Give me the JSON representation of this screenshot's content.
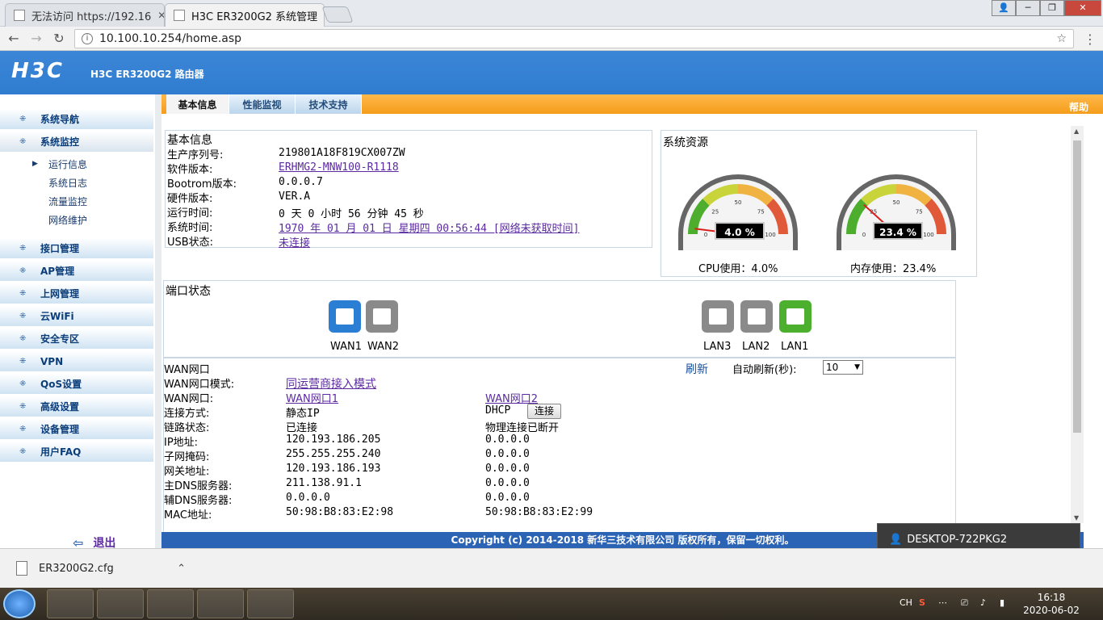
{
  "browser": {
    "tabs": [
      {
        "title": "无法访问 https://192.16"
      },
      {
        "title": "H3C ER3200G2 系统管理"
      }
    ],
    "url": "10.100.10.254/home.asp"
  },
  "header": {
    "logo": "H3C",
    "model": "H3C ER3200G2 路由器"
  },
  "sidebar": {
    "items": [
      {
        "label": "系统导航"
      },
      {
        "label": "系统监控"
      },
      {
        "label": "接口管理"
      },
      {
        "label": "AP管理"
      },
      {
        "label": "上网管理"
      },
      {
        "label": "云WiFi"
      },
      {
        "label": "安全专区"
      },
      {
        "label": "VPN"
      },
      {
        "label": "QoS设置"
      },
      {
        "label": "高级设置"
      },
      {
        "label": "设备管理"
      },
      {
        "label": "用户FAQ"
      }
    ],
    "sub_items": [
      {
        "label": "运行信息"
      },
      {
        "label": "系统日志"
      },
      {
        "label": "流量监控"
      },
      {
        "label": "网络维护"
      }
    ],
    "logout": "退出"
  },
  "tabs": [
    {
      "label": "基本信息"
    },
    {
      "label": "性能监视"
    },
    {
      "label": "技术支持"
    }
  ],
  "help": "帮助",
  "basic_info": {
    "title": "基本信息",
    "rows": [
      {
        "label": "生产序列号:",
        "value": "219801A18F819CX007ZW"
      },
      {
        "label": "软件版本:",
        "value": "ERHMG2-MNW100-R1118"
      },
      {
        "label": "Bootrom版本:",
        "value": "0.0.0.7"
      },
      {
        "label": "硬件版本:",
        "value": "VER.A"
      },
      {
        "label": "运行时间:",
        "value": "0 天 0 小时 56 分钟 45 秒"
      },
      {
        "label": "系统时间:",
        "value": "1970 年 01 月 01 日 星期四 00:56:44    [网络未获取时间]"
      },
      {
        "label": "USB状态:",
        "value": "未连接"
      }
    ]
  },
  "resources": {
    "title": "系统资源",
    "cpu": {
      "value": 4.0,
      "display": "4.0 %",
      "label": "CPU使用：4.0%"
    },
    "mem": {
      "value": 23.4,
      "display": "23.4 %",
      "label": "内存使用：23.4%"
    },
    "ticks": [
      "0",
      "25",
      "50",
      "75",
      "100"
    ]
  },
  "ports": {
    "title": "端口状态",
    "items": [
      {
        "label": "WAN1",
        "state": "active-blue"
      },
      {
        "label": "WAN2",
        "state": "inactive"
      },
      {
        "label": "LAN3",
        "state": "inactive"
      },
      {
        "label": "LAN2",
        "state": "inactive"
      },
      {
        "label": "LAN1",
        "state": "active-green"
      }
    ]
  },
  "wan": {
    "title": "WAN网口",
    "refresh": "刷新",
    "auto_refresh_label": "自动刷新(秒):",
    "auto_refresh_value": "10",
    "mode_label": "WAN网口模式:",
    "mode_value": "同运营商接入模式",
    "port_label": "WAN网口:",
    "port1": "WAN网口1",
    "port2": "WAN网口2",
    "connect_button": "连接",
    "rows": [
      {
        "label": "连接方式:",
        "v1": "静态IP",
        "v2": "DHCP"
      },
      {
        "label": "链路状态:",
        "v1": "已连接",
        "v2": "物理连接已断开"
      },
      {
        "label": "IP地址:",
        "v1": "120.193.186.205",
        "v2": "0.0.0.0"
      },
      {
        "label": "子网掩码:",
        "v1": "255.255.255.240",
        "v2": "0.0.0.0"
      },
      {
        "label": "网关地址:",
        "v1": "120.193.186.193",
        "v2": "0.0.0.0"
      },
      {
        "label": "主DNS服务器:",
        "v1": "211.138.91.1",
        "v2": "0.0.0.0"
      },
      {
        "label": "辅DNS服务器:",
        "v1": "0.0.0.0",
        "v2": "0.0.0.0"
      },
      {
        "label": "MAC地址:",
        "v1": "50:98:B8:83:E2:98",
        "v2": "50:98:B8:83:E2:99"
      }
    ]
  },
  "footer": "Copyright (c) 2014-2018 新华三技术有限公司 版权所有，保留一切权利。",
  "remote": {
    "name": "DESKTOP-722PKG2"
  },
  "download": {
    "file": "ER3200G2.cfg"
  },
  "taskbar": {
    "lang": "CH",
    "time": "16:18",
    "date": "2020-06-02"
  },
  "colors": {
    "accent": "#2f7cd0",
    "tabbar": "#f49d1a",
    "link": "#5b2aa0",
    "port_blue": "#2a7fd4",
    "port_green": "#4caf2e",
    "port_gray": "#8a8a8a"
  }
}
